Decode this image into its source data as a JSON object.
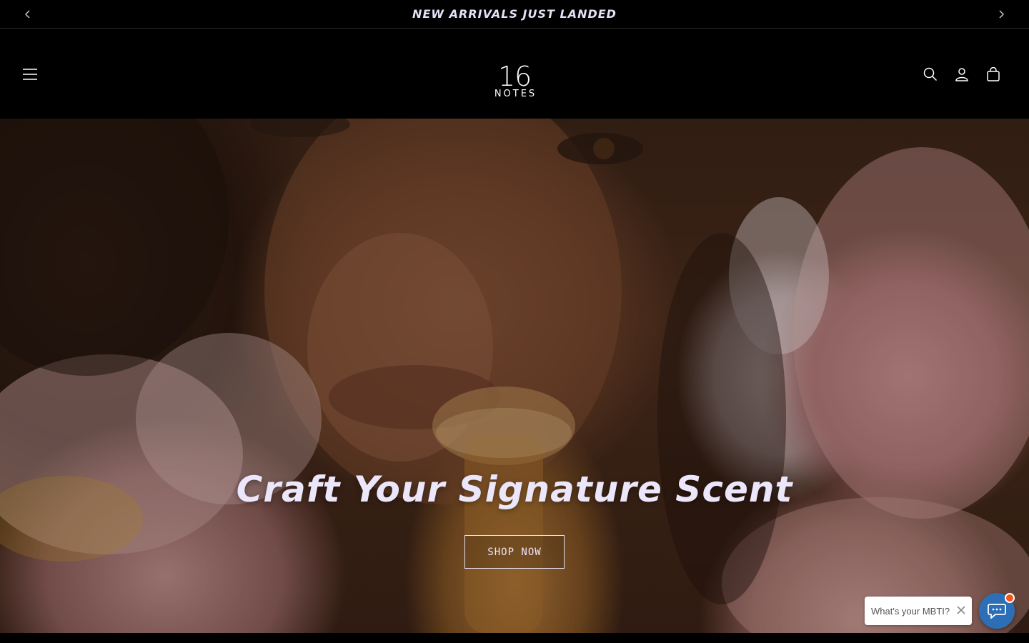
{
  "announcement": {
    "text": "NEW ARRIVALS JUST LANDED",
    "prev_icon": "chevron-left-icon",
    "next_icon": "chevron-right-icon"
  },
  "header": {
    "logo": {
      "number": "16",
      "word": "NOTES"
    },
    "icons": {
      "menu": "hamburger-menu-icon",
      "search": "search-icon",
      "account": "account-icon",
      "cart": "cart-icon"
    }
  },
  "hero": {
    "title": "Craft Your Signature Scent",
    "button_label": "SHOP NOW"
  },
  "chat_widget": {
    "prompt": "What's your MBTI?",
    "close_icon": "close-icon",
    "launcher_icon": "chat-bubble-icon"
  },
  "colors": {
    "page_background": "#000000",
    "accent_text": "#ece6fa",
    "chat_launcher": "#2c6fb6",
    "chat_badge": "#f2541b"
  }
}
